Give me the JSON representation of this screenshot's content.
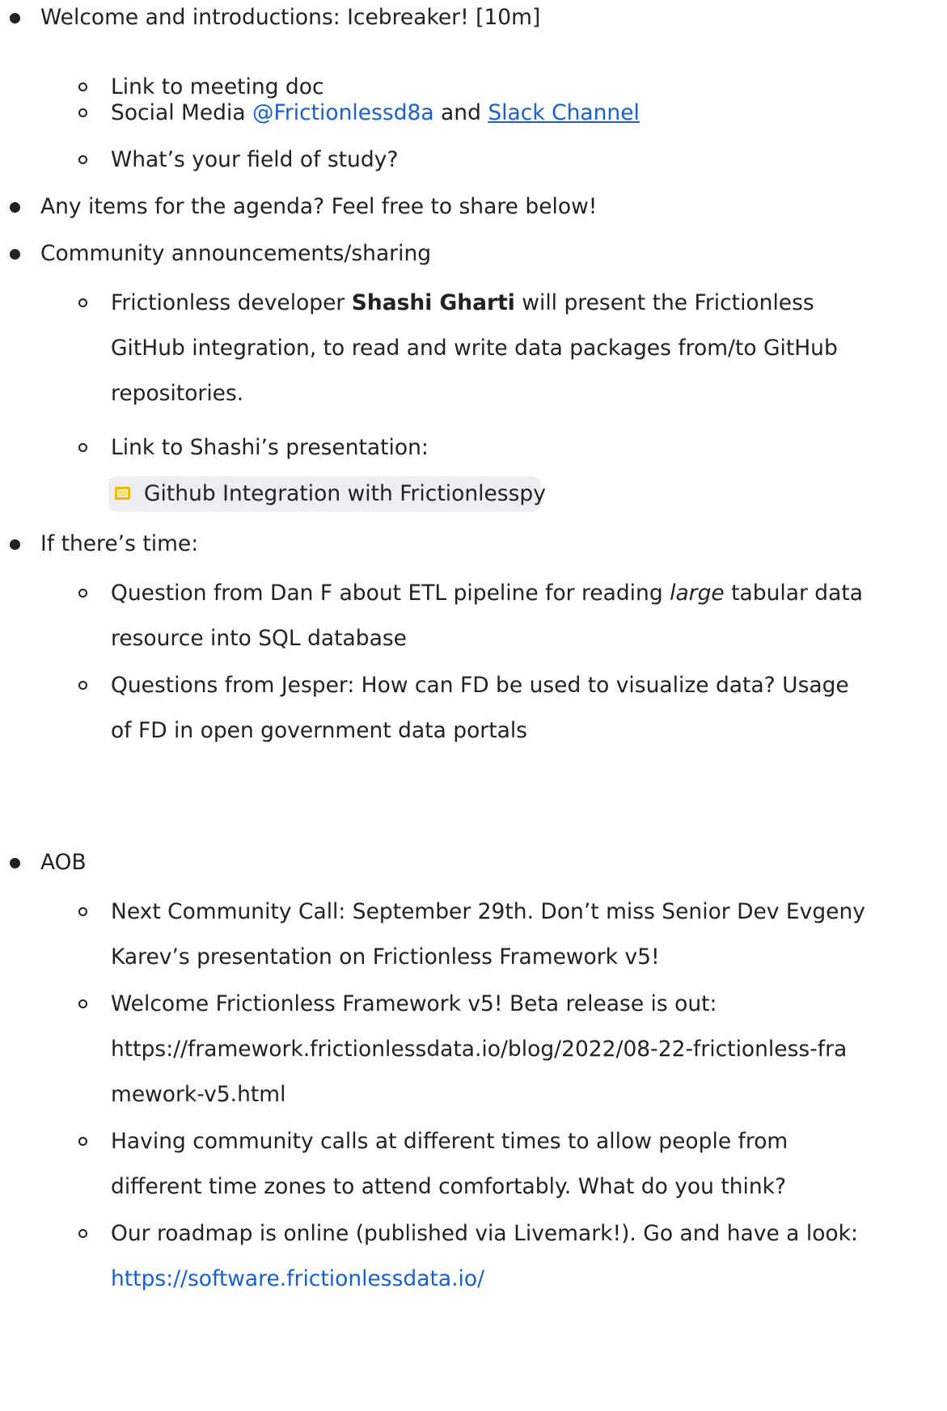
{
  "items": {
    "welcome": "Welcome and introductions: Icebreaker! [10m]",
    "link_meeting_doc": "Link to meeting doc",
    "social_prefix": "Social Media ",
    "social_mention": "@Frictionlessd8a",
    "social_and": " and ",
    "social_slack": "Slack Channel",
    "field_of_study": "What’s your field of study?",
    "agenda_items": "Any items for the agenda? Feel free to share below!",
    "community": "Community announcements/sharing",
    "shashi_pre": "Frictionless developer ",
    "shashi_name": "Shashi Gharti",
    "shashi_post": " will present the Frictionless",
    "shashi_line2": "GitHub integration, to read and write data packages from/to GitHub",
    "shashi_line3": "repositories.",
    "presentation_link": "Link to Shashi’s presentation:",
    "chip_label": "Github Integration with Frictionlesspy",
    "if_time": "If there’s time:",
    "danf_pre": "Question from Dan F about ETL pipeline for reading ",
    "danf_italic": "large",
    "danf_post": "  tabular data",
    "danf_line2": "resource into SQL database",
    "jesper_line1": "Questions from Jesper: How can FD be used to visualize data? Usage",
    "jesper_line2": "of FD in open government data portals",
    "aob": "AOB",
    "next_call_line1": "Next Community Call: September 29th. Don’t miss Senior Dev Evgeny",
    "next_call_line2": "Karev’s presentation on Frictionless Framework v5!",
    "v5_line1": "Welcome Frictionless Framework v5! Beta release is out:",
    "v5_line2": "https://framework.frictionlessdata.io/blog/2022/08-22-frictionless-fra",
    "v5_line3": "mework-v5.html",
    "calls_line1": "Having community calls at different times to allow people from",
    "calls_line2": "different time zones to attend comfortably. What do you think?",
    "roadmap_line1": "Our roadmap is online (published via Livemark!). Go and have a look:",
    "roadmap_link": "https://software.frictionlessdata.io/"
  },
  "colors": {
    "text": "#222222",
    "link": "#1a5fd0",
    "chip_bg": "#eceef1",
    "chip_icon": "#f4b400"
  },
  "icons": {
    "chip_icon": "google-slides-icon"
  }
}
